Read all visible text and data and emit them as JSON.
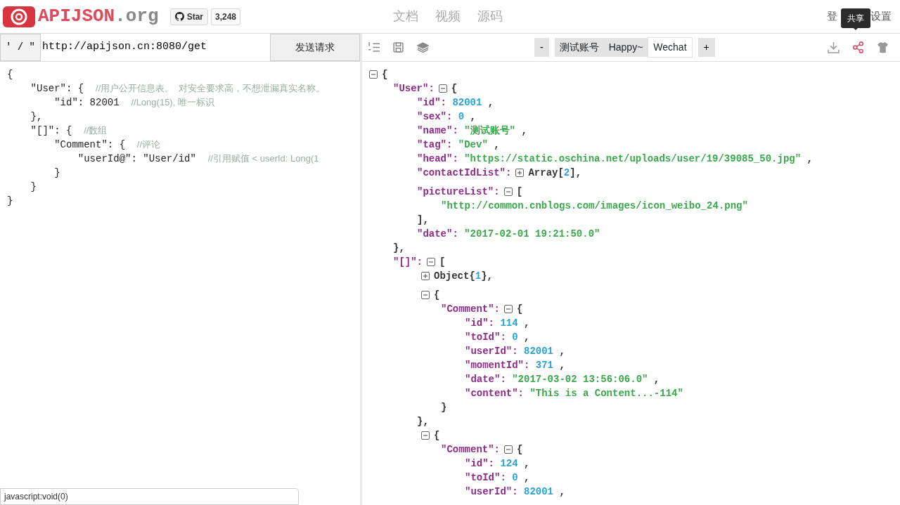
{
  "header": {
    "logo_text": "APIJSON",
    "logo_suffix": ".org",
    "github": {
      "label": "Star",
      "count": "3,248"
    },
    "nav": [
      "文档",
      "视频",
      "源码"
    ],
    "right_links": [
      "登",
      "设置"
    ],
    "tooltip": "共享"
  },
  "request": {
    "quote_button": "' / \"",
    "url": "http://apijson.cn:8080/get",
    "send_button": "发送请求"
  },
  "editor": {
    "lines": [
      {
        "code": "{"
      },
      {
        "code": "    \"User\": {  ",
        "comment": "//用户公开信息表。  对安全要求高，不想泄漏真实名称。"
      },
      {
        "code": "        \"id\": 82001  ",
        "comment": "//Long(15), 唯一标识"
      },
      {
        "code": "    },"
      },
      {
        "code": "    \"[]\": {  ",
        "comment": "//数组"
      },
      {
        "code": "        \"Comment\": {  ",
        "comment": "//评论"
      },
      {
        "code": "            \"userId@\": \"User/id\"  ",
        "comment": "//引用赋值 < userId: Long(1"
      },
      {
        "code": "        }"
      },
      {
        "code": "    }"
      },
      {
        "code": "}"
      }
    ]
  },
  "toolbar": {
    "left_tools": [
      {
        "kind": "list"
      },
      {
        "kind": "save"
      },
      {
        "kind": "layers"
      }
    ],
    "minus": "-",
    "plus": "+",
    "accounts": [
      {
        "label": "测试账号",
        "selected": false
      },
      {
        "label": "Happy~",
        "selected": false
      },
      {
        "label": "Wechat",
        "selected": true
      }
    ],
    "right_tools": [
      {
        "kind": "download",
        "active": false
      },
      {
        "kind": "share",
        "active": true
      },
      {
        "kind": "shirt",
        "active": false
      }
    ]
  },
  "response": {
    "root": {
      "expanded": true,
      "open": "{",
      "children": [
        {
          "key": "\"User\":",
          "expanded": true,
          "open": "{",
          "close": "},",
          "children": [
            {
              "key": "\"id\":",
              "value": "82001",
              "kind": "number",
              "suffix": " ,"
            },
            {
              "key": "\"sex\":",
              "value": "0",
              "kind": "number",
              "suffix": " ,"
            },
            {
              "key": "\"name\":",
              "value": "\"测试账号\"",
              "kind": "string",
              "suffix": " ,"
            },
            {
              "key": "\"tag\":",
              "value": "\"Dev\"",
              "kind": "string",
              "suffix": " ,"
            },
            {
              "key": "\"head\":",
              "value": "\"https://static.oschina.net/uploads/user/19/39085_50.jpg\"",
              "kind": "string",
              "suffix": " ,"
            },
            {
              "key": "\"contactIdList\":",
              "expanded": false,
              "label": "Array[",
              "count": "2",
              "label_end": "],"
            },
            {
              "key": "\"pictureList\":",
              "expanded": true,
              "open": "[",
              "close": "],",
              "children": [
                {
                  "value": "\"http://common.cnblogs.com/images/icon_weibo_24.png\"",
                  "kind": "string"
                }
              ]
            },
            {
              "key": "\"date\":",
              "value": "\"2017-02-01 19:21:50.0\"",
              "kind": "string"
            }
          ]
        },
        {
          "key": "\"[]\":",
          "expanded": true,
          "open": "[",
          "children": [
            {
              "expanded": false,
              "label": "Object{",
              "count": "1",
              "label_end": "},"
            },
            {
              "expanded": true,
              "open": "{",
              "close": "},",
              "children": [
                {
                  "key": "\"Comment\":",
                  "expanded": true,
                  "open": "{",
                  "close": "}",
                  "children": [
                    {
                      "key": "\"id\":",
                      "value": "114",
                      "kind": "number",
                      "suffix": " ,"
                    },
                    {
                      "key": "\"toId\":",
                      "value": "0",
                      "kind": "number",
                      "suffix": " ,"
                    },
                    {
                      "key": "\"userId\":",
                      "value": "82001",
                      "kind": "number",
                      "suffix": " ,"
                    },
                    {
                      "key": "\"momentId\":",
                      "value": "371",
                      "kind": "number",
                      "suffix": " ,"
                    },
                    {
                      "key": "\"date\":",
                      "value": "\"2017-03-02 13:56:06.0\"",
                      "kind": "string",
                      "suffix": " ,"
                    },
                    {
                      "key": "\"content\":",
                      "value": "\"This is a Content...-114\"",
                      "kind": "string"
                    }
                  ]
                }
              ]
            },
            {
              "expanded": true,
              "open": "{",
              "children": [
                {
                  "key": "\"Comment\":",
                  "expanded": true,
                  "open": "{",
                  "children": [
                    {
                      "key": "\"id\":",
                      "value": "124",
                      "kind": "number",
                      "suffix": " ,"
                    },
                    {
                      "key": "\"toId\":",
                      "value": "0",
                      "kind": "number",
                      "suffix": " ,"
                    },
                    {
                      "key": "\"userId\":",
                      "value": "82001",
                      "kind": "number",
                      "suffix": " ,"
                    }
                  ]
                }
              ]
            }
          ]
        }
      ]
    }
  },
  "status_bar": "javascript:void(0)"
}
